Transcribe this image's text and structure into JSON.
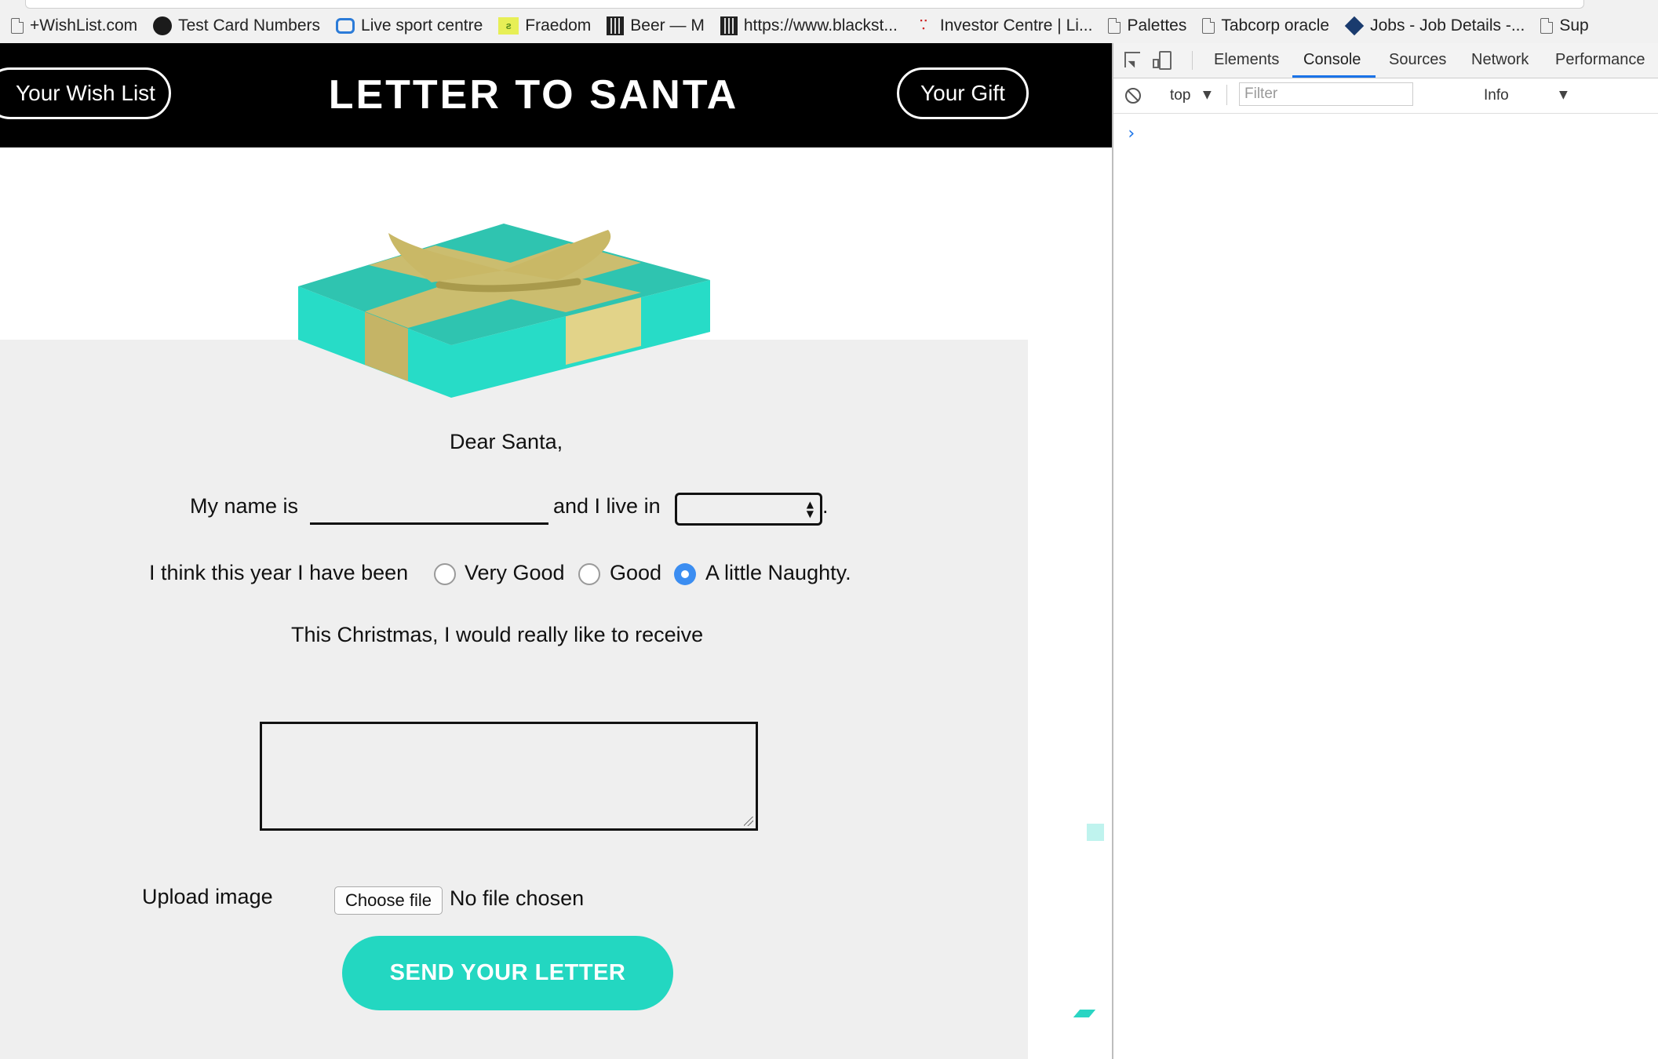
{
  "bookmarks": [
    {
      "label": "+WishList.com",
      "icon": "page-icon"
    },
    {
      "label": "Test Card Numbers",
      "icon": "github-icon"
    },
    {
      "label": "Live sport centre",
      "icon": "ie-icon"
    },
    {
      "label": "Fraedom",
      "icon": "fraedom-icon"
    },
    {
      "label": "Beer — M",
      "icon": "beer-icon"
    },
    {
      "label": "https://www.blackst...",
      "icon": "site-icon"
    },
    {
      "label": "Investor Centre | Li...",
      "icon": "link-icon"
    },
    {
      "label": "Palettes",
      "icon": "page-icon"
    },
    {
      "label": "Tabcorp oracle",
      "icon": "page-icon"
    },
    {
      "label": "Jobs - Job Details -...",
      "icon": "jobs-icon"
    },
    {
      "label": "Sup",
      "icon": "page-icon"
    }
  ],
  "header": {
    "wish_list_button": "Your Wish List",
    "title": "LETTER TO SANTA",
    "gift_button": "Your Gift"
  },
  "letter": {
    "greeting": "Dear Santa,",
    "name_label": "My name is",
    "name_value": "",
    "live_label": "and I live in",
    "city_value": "",
    "period": ".",
    "behaviour_label": "I think this year I have been",
    "options": [
      "Very Good",
      "Good",
      "A little Naughty."
    ],
    "selected_option": "A little Naughty.",
    "wish_label": "This Christmas, I would really like to receive",
    "wish_value": "",
    "upload_label": "Upload image",
    "choose_file_button": "Choose file",
    "no_file_text": "No file chosen",
    "send_button": "SEND YOUR LETTER"
  },
  "colors": {
    "accent": "#23d7c1",
    "gift_teal": "#2fc4b0",
    "gift_gold": "#cbbd6f",
    "radio_selected": "#3b8df1"
  },
  "devtools": {
    "tabs": [
      "Elements",
      "Console",
      "Sources",
      "Network",
      "Performance"
    ],
    "active_tab": "Console",
    "context": "top",
    "filter_placeholder": "Filter",
    "level": "Info",
    "prompt": "›"
  }
}
